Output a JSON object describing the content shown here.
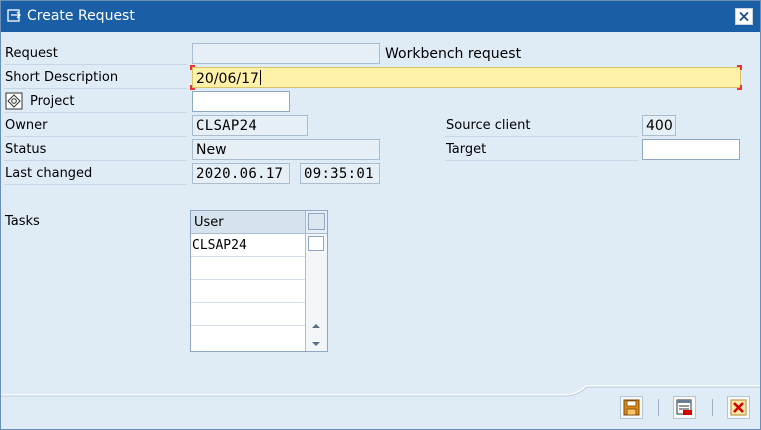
{
  "window": {
    "title": "Create Request"
  },
  "form": {
    "request_label": "Request",
    "request_value": "",
    "request_type": "Workbench request",
    "short_desc_label": "Short Description",
    "short_desc_value": "20/06/17",
    "project_label": "Project",
    "project_value": "",
    "owner_label": "Owner",
    "owner_value": "CLSAP24",
    "status_label": "Status",
    "status_value": "New",
    "last_changed_label": "Last changed",
    "last_changed_date": "2020.06.17",
    "last_changed_time": "09:35:01",
    "source_client_label": "Source client",
    "source_client_value": "400",
    "target_label": "Target",
    "target_value": ""
  },
  "tasks": {
    "label": "Tasks",
    "column_header": "User",
    "rows": [
      "CLSAP24",
      "",
      "",
      "",
      ""
    ]
  },
  "toolbar": {
    "buttons": [
      "save-icon",
      "new-request-icon",
      "cancel-icon"
    ]
  },
  "colors": {
    "titlebar": "#1a5fa6",
    "window_bg": "#dfebf5",
    "active_field": "#fff2a8",
    "cancel_red": "#d40000"
  }
}
